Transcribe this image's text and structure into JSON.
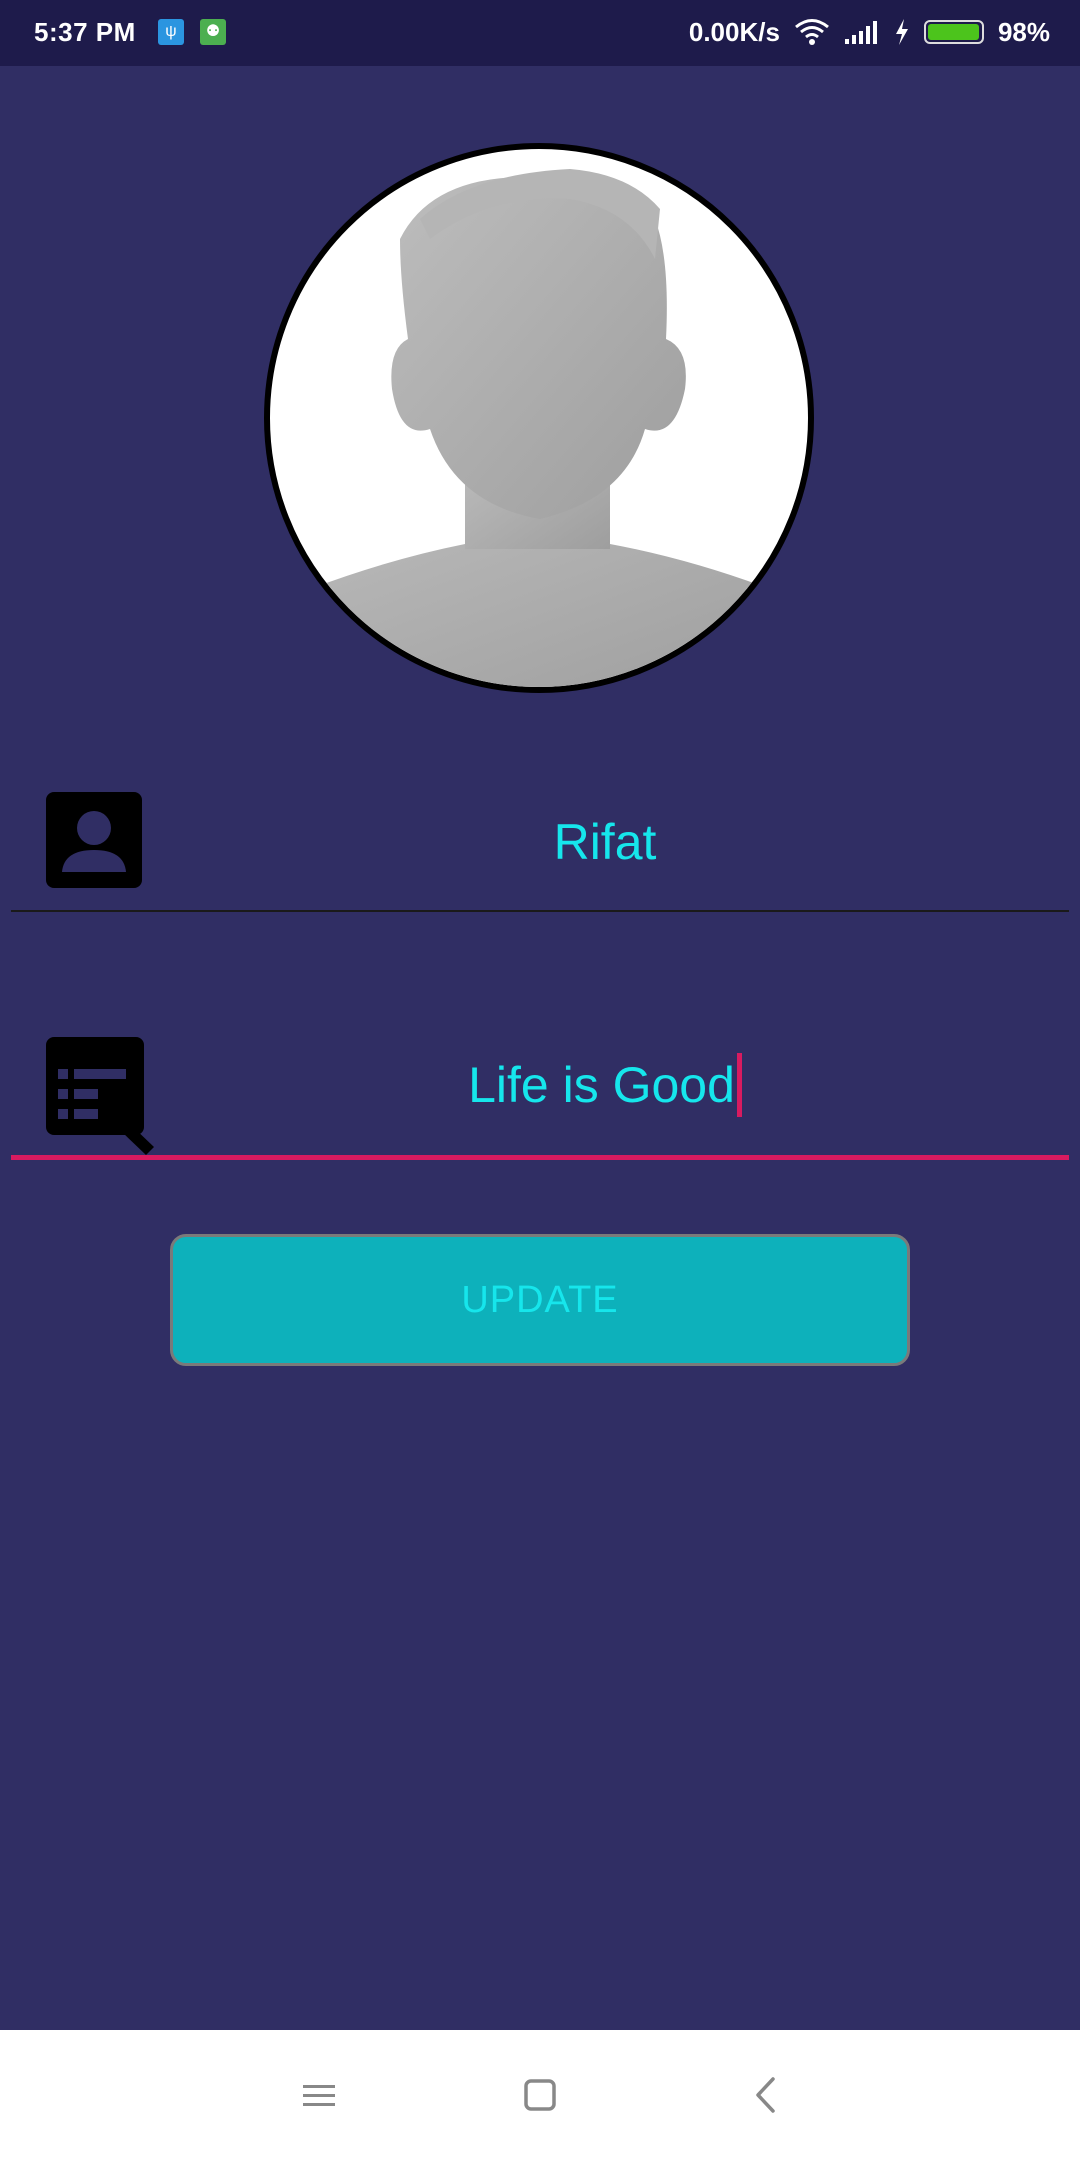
{
  "status_bar": {
    "time": "5:37 PM",
    "network_speed": "0.00K/s",
    "battery_percent": "98%",
    "battery_level": 0.98,
    "notification_icons": [
      "usb-icon",
      "android-icon"
    ],
    "icons": [
      "wifi-icon",
      "signal-icon",
      "charging-icon",
      "battery-icon"
    ]
  },
  "profile": {
    "avatar_icon": "default-avatar-icon",
    "name_icon": "person-icon",
    "name_value": "Rifat",
    "status_icon": "edit-note-icon",
    "status_value": "Life is Good"
  },
  "actions": {
    "update_label": "UPDATE"
  },
  "navigation": {
    "icons": [
      "menu-icon",
      "home-icon",
      "back-icon"
    ]
  },
  "colors": {
    "background": "#302e64",
    "status_bar": "#1e1b4b",
    "text_accent": "#16e6ec",
    "focus_accent": "#d81b60",
    "button": "#0db1bb"
  }
}
